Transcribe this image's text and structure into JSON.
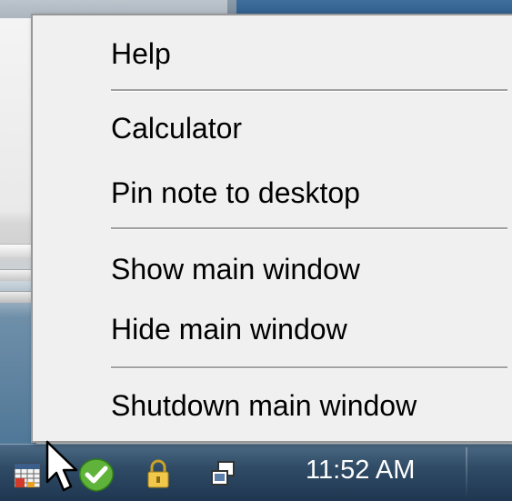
{
  "menu": {
    "items": [
      {
        "label": "Help"
      },
      {
        "label": "Calculator"
      },
      {
        "label": "Pin note to desktop"
      },
      {
        "label": "Show main window"
      },
      {
        "label": "Hide main window"
      },
      {
        "label": "Shutdown main window"
      }
    ]
  },
  "taskbar": {
    "clock": "11:52 AM",
    "tray_icons": [
      "app-calendar-icon",
      "security-shield-icon",
      "lock-icon",
      "network-icon"
    ]
  },
  "colors": {
    "menu_bg": "#f0f0f0",
    "taskbar": "#2f4b66",
    "separator": "#a0a0a0"
  }
}
